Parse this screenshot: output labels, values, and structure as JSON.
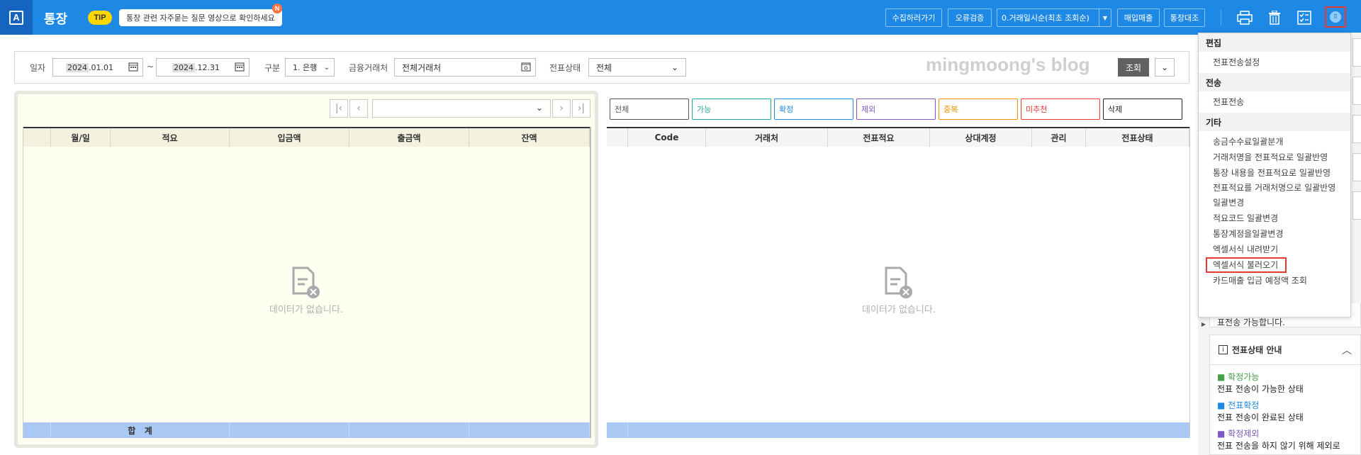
{
  "app": {
    "title": "통장",
    "logo": "A"
  },
  "tip": {
    "badge": "TIP",
    "text": "통장 관련 자주묻는 질문 영상으로 확인하세요",
    "new_badge": "N"
  },
  "toolbar": {
    "collect_label": "수집하러가기",
    "verify_label": "오류검증",
    "sort_label": "0.거래일시순(최초 조회순)",
    "purchase_label": "매입매출",
    "reconcile_label": "통장대조",
    "icons": [
      "print-icon",
      "trash-icon",
      "checklist-icon",
      "more-menu-icon"
    ]
  },
  "search": {
    "date_label": "일자",
    "date_from_year": "2024",
    "date_from_rest": ".01.01",
    "date_to_year": "2024",
    "date_to_rest": ".12.31",
    "range_sep": "~",
    "type_label": "구분",
    "type_value": "1. 은행",
    "fin_label": "금융거래처",
    "fin_value": "전체거래처",
    "status_label": "전표상태",
    "status_value": "전체",
    "watermark": "mingmoong's blog",
    "search_button": "조회"
  },
  "left_grid": {
    "columns": [
      "월/일",
      "적요",
      "입금액",
      "출금액",
      "잔액"
    ],
    "empty_text": "데이터가 없습니다.",
    "footer_label": "합   계"
  },
  "right_grid": {
    "filters": [
      {
        "label": "전체",
        "color": "#555555"
      },
      {
        "label": "가능",
        "color": "#26a69a"
      },
      {
        "label": "확정",
        "color": "#1e88e5"
      },
      {
        "label": "제외",
        "color": "#7e57c2"
      },
      {
        "label": "중복",
        "color": "#fb8c00"
      },
      {
        "label": "미추천",
        "color": "#e53935"
      },
      {
        "label": "삭제",
        "color": "#222222"
      }
    ],
    "columns": [
      "Code",
      "거래처",
      "전표적요",
      "상대계정",
      "관리",
      "전표상태"
    ],
    "empty_text": "데이터가 없습니다."
  },
  "menu": {
    "sections": [
      {
        "title": "편집",
        "items": [
          "전표전송설정"
        ]
      },
      {
        "title": "전송",
        "items": [
          "전표전송"
        ]
      },
      {
        "title": "기타",
        "items": [
          "송금수수료일괄분개",
          "거래처명을 전표적요로 일괄반영",
          "통장 내용을 전표적요로 일괄반영",
          "전표적요를 거래처명으로 일괄반영",
          "일괄변경",
          "적요코드 일괄변경",
          "통장계정을일괄변경",
          "엑셀서식 내려받기",
          "엑셀서식 불러오기",
          "카드매출 입금 예정액 조회"
        ]
      }
    ],
    "highlighted_item": "엑셀서식 불러오기"
  },
  "side_panel": {
    "partial_text": "표전송 가능합니다.",
    "state_title": "전표상태 안내",
    "states": [
      {
        "name": "확정가능",
        "desc": "전표 전송이 가능한 상태",
        "color": "#43a047"
      },
      {
        "name": "전표확정",
        "desc": "전표 전송이 완료된 상태",
        "color": "#1e88e5"
      },
      {
        "name": "확정제외",
        "desc": "전표 전송을 하지 않기 위해 제외로",
        "color": "#7e57c2"
      }
    ]
  }
}
